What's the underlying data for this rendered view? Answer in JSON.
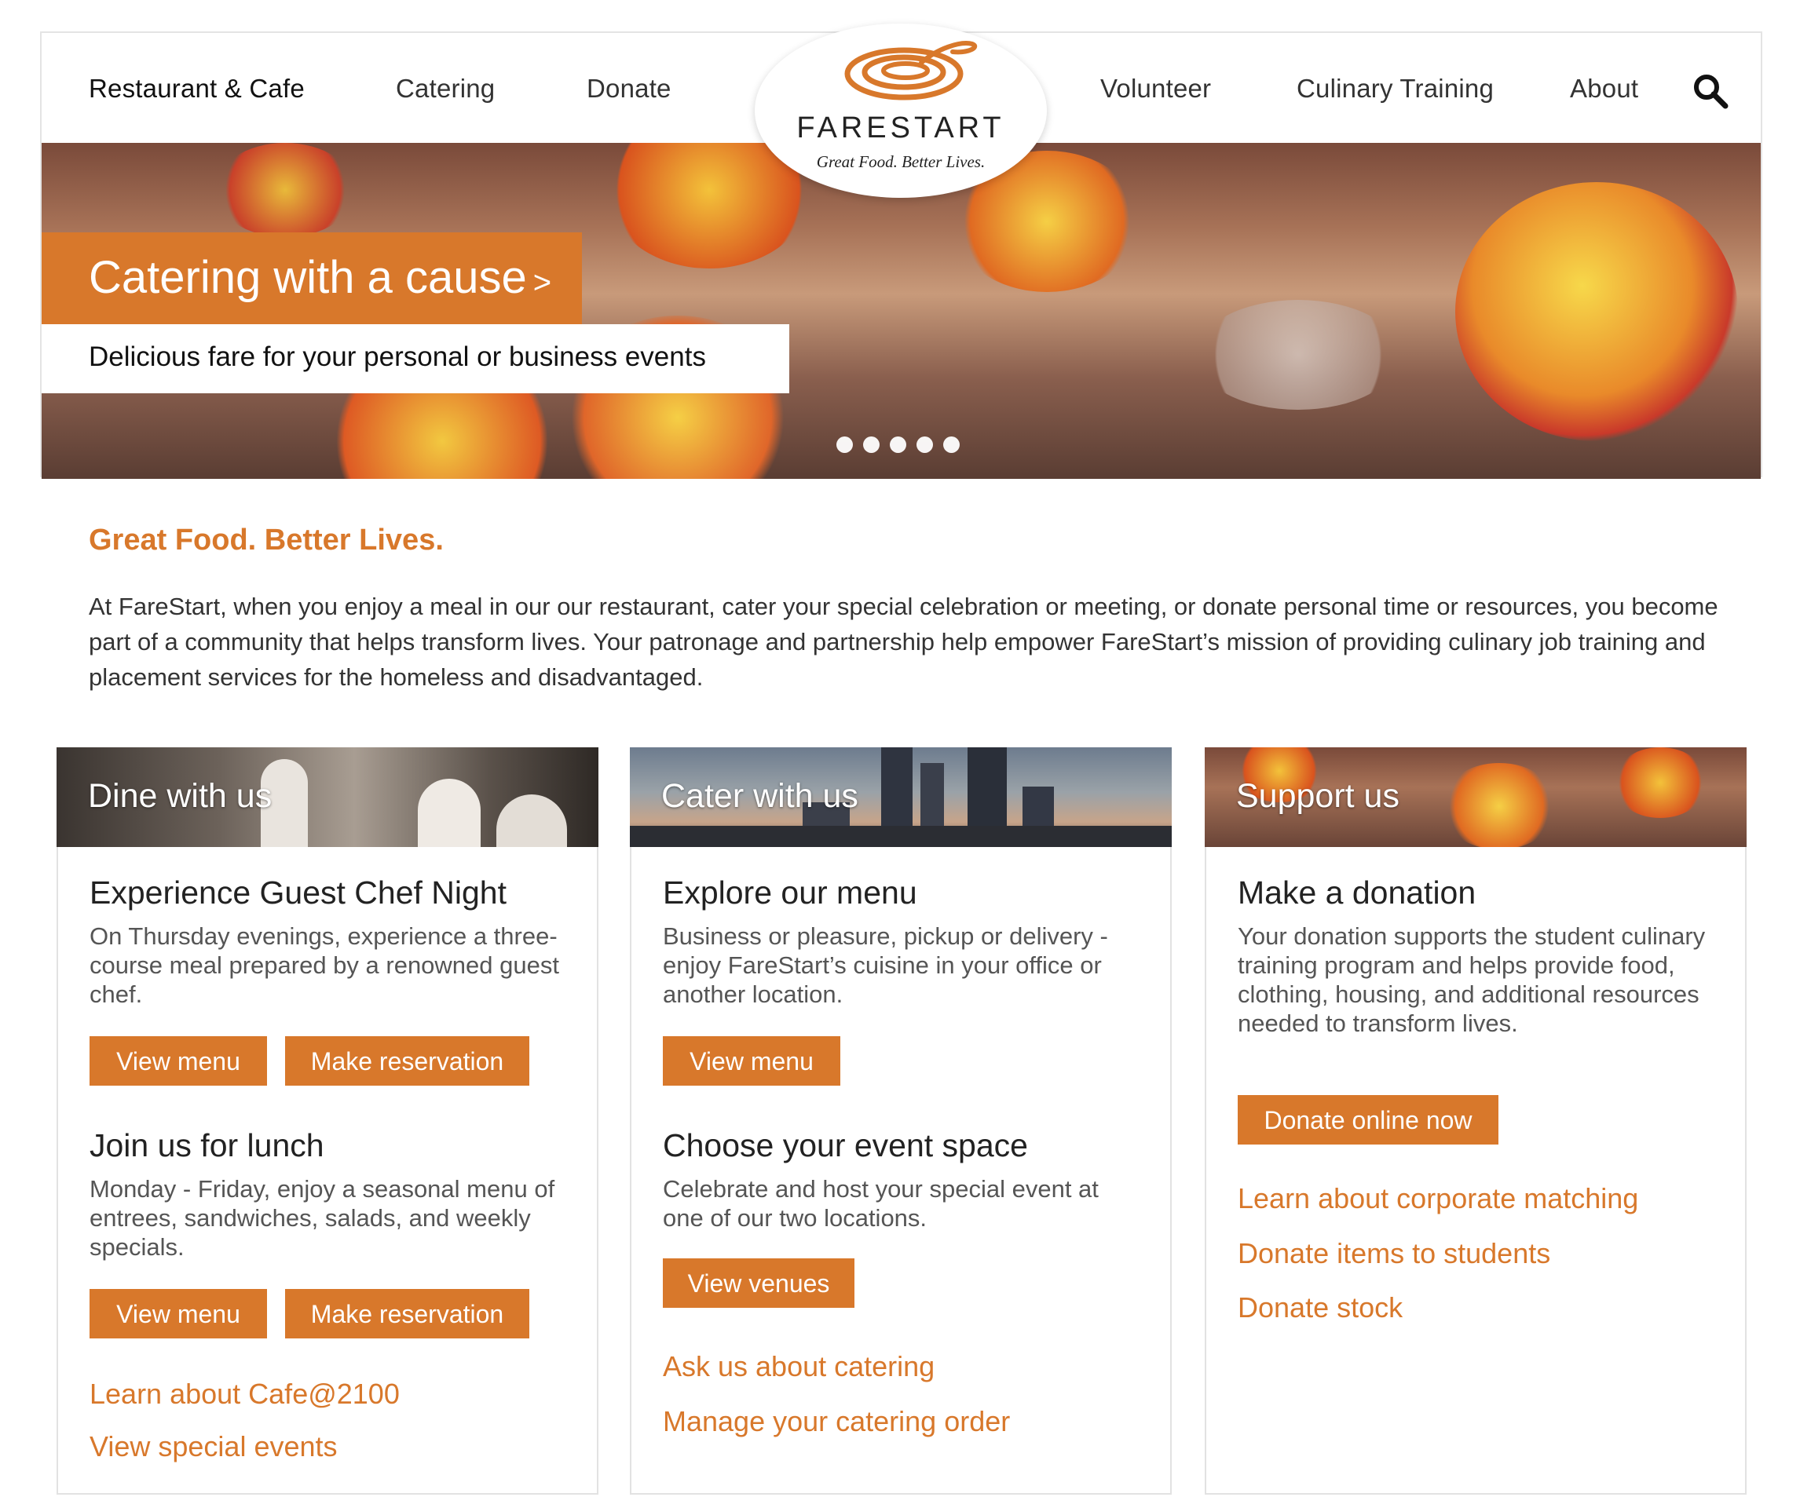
{
  "nav": {
    "left": [
      "Restaurant & Cafe",
      "Catering",
      "Donate"
    ],
    "right": [
      "Volunteer",
      "Culinary Training",
      "About"
    ]
  },
  "logo": {
    "name": "FARESTART",
    "tagline": "Great Food. Better Lives."
  },
  "hero": {
    "title": "Catering with a cause",
    "title_chevron": ">",
    "subtitle": "Delicious fare for your personal or business events",
    "slide_count": 5
  },
  "intro": {
    "title": "Great Food. Better Lives.",
    "text": "At FareStart, when you enjoy a meal in our our restaurant, cater your special celebration or meeting, or donate personal time or resources, you become part of a community that helps transform lives. Your patronage and partnership help empower FareStart’s mission of providing culinary job training and placement services for the homeless and disadvantaged."
  },
  "cards": {
    "dine": {
      "title": "Dine with us",
      "section1_title": "Experience Guest Chef Night",
      "section1_text": "On Thursday evenings, experience a three-course meal prepared by a renowned guest chef.",
      "section1_btn1": "View menu",
      "section1_btn2": "Make reservation",
      "section2_title": "Join us for lunch",
      "section2_text": "Monday - Friday, enjoy a seasonal menu of entrees, sandwiches, salads, and weekly specials.",
      "section2_btn1": "View menu",
      "section2_btn2": "Make reservation",
      "link1": "Learn about Cafe@2100",
      "link2": "View special events"
    },
    "cater": {
      "title": "Cater with us",
      "section1_title": "Explore our menu",
      "section1_text": "Business or pleasure, pickup or delivery - enjoy FareStart’s cuisine in your office or another location.",
      "section1_btn1": "View menu",
      "section2_title": "Choose your event space",
      "section2_text": "Celebrate and host your special event at one of our two locations.",
      "section2_btn1": "View venues",
      "link1": "Ask us about catering",
      "link2": "Manage your catering order"
    },
    "support": {
      "title": "Support us",
      "section1_title": "Make a donation",
      "section1_text": "Your donation supports the student culinary training program and helps provide food, clothing, housing, and additional resources needed to transform lives.",
      "section1_btn1": "Donate online now",
      "link1": "Learn about corporate matching",
      "link2": "Donate items to students",
      "link3": "Donate stock"
    }
  },
  "colors": {
    "accent": "#d8782b",
    "text": "#333333",
    "border": "#e2e2e2"
  },
  "icons": {
    "search": "search-icon",
    "logo": "farestart-logo-icon"
  }
}
